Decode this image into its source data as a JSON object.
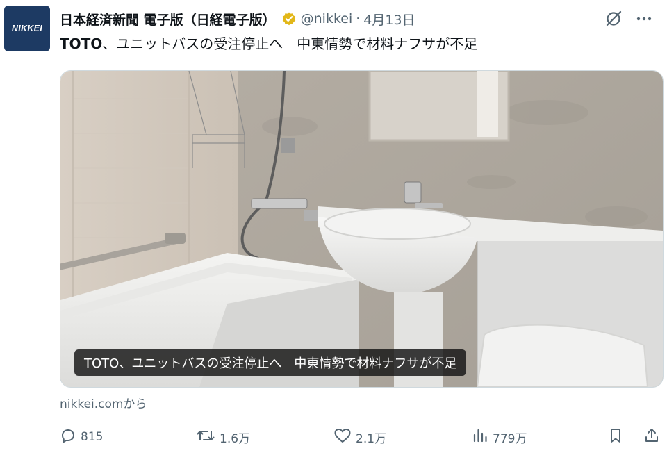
{
  "account": {
    "logo_text": "NIKKEI",
    "display_name": "日本経済新聞 電子版（日経電子版）",
    "handle": "@nikkei",
    "separator": "·",
    "date": "4月13日",
    "verified_color": "#e2b719"
  },
  "tweet": {
    "text_bold": "TOTO",
    "text_rest": "、ユニットバスの受注停止へ　中東情勢で材料ナフサが不足"
  },
  "card": {
    "caption": "TOTO、ユニットバスの受注停止へ　中東情勢で材料ナフサが不足",
    "source": "nikkei.comから"
  },
  "actions": {
    "replies": "815",
    "reposts": "1.6万",
    "likes": "2.1万",
    "views": "779万"
  },
  "icons": {
    "grok": "grok-icon",
    "more": "more-icon",
    "reply": "reply-icon",
    "repost": "repost-icon",
    "like": "heart-icon",
    "views": "views-icon",
    "bookmark": "bookmark-icon",
    "share": "share-icon"
  },
  "colors": {
    "text": "#0f1419",
    "muted": "#536471",
    "logo_bg": "#1d3a63"
  }
}
